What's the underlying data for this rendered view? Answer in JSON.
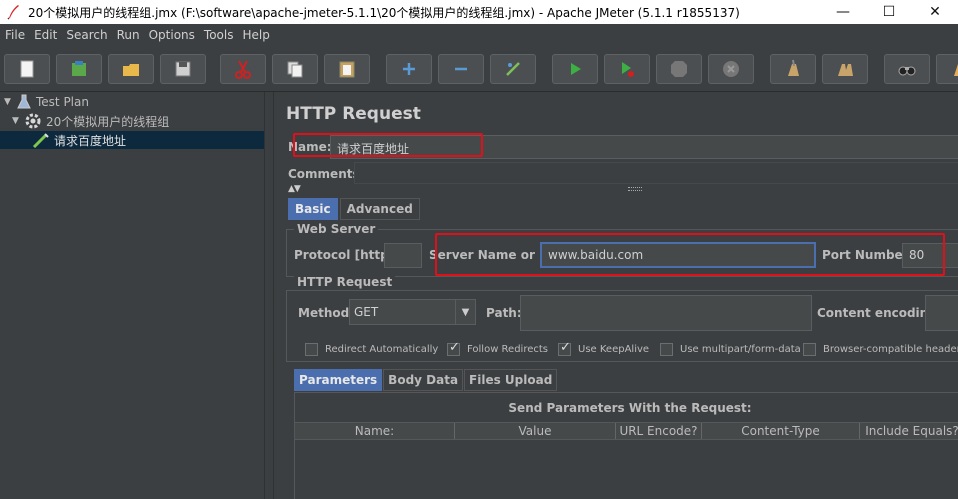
{
  "window": {
    "title": "20个模拟用户的线程组.jmx (F:\\software\\apache-jmeter-5.1.1\\20个模拟用户的线程组.jmx) - Apache JMeter (5.1.1 r1855137)",
    "minimize": "—",
    "maximize": "☐",
    "close": "✕"
  },
  "menu": [
    "File",
    "Edit",
    "Search",
    "Run",
    "Options",
    "Tools",
    "Help"
  ],
  "toolbar": {
    "icons": [
      "new-icon",
      "templates-icon",
      "open-icon",
      "save-icon",
      "cut-icon",
      "copy-icon",
      "paste-icon",
      "expand-icon",
      "collapse-icon",
      "toggle-icon",
      "start-icon",
      "start-no-pause-icon",
      "stop-icon",
      "shutdown-icon",
      "clear-icon",
      "clear-all-icon",
      "search-icon",
      "reset-search-icon"
    ]
  },
  "tree": {
    "items": [
      {
        "label": "Test Plan",
        "icon": "flask-icon",
        "expanded": true
      },
      {
        "label": "20个模拟用户的线程组",
        "icon": "gear-icon",
        "expanded": true
      },
      {
        "label": "请求百度地址",
        "icon": "pipette-icon",
        "selected": true
      }
    ]
  },
  "form": {
    "title": "HTTP Request",
    "name_label": "Name:",
    "name_value": "请求百度地址",
    "comments_label": "Comments:",
    "tabs": [
      "Basic",
      "Advanced"
    ],
    "web_server": {
      "title": "Web Server",
      "protocol_label": "Protocol [http]:",
      "protocol_value": "",
      "server_label": "Server Name or IP:",
      "server_value": "www.baidu.com",
      "port_label": "Port Number:",
      "port_value": "80"
    },
    "http_request": {
      "title": "HTTP Request",
      "method_label": "Method:",
      "method_value": "GET",
      "path_label": "Path:",
      "path_value": "",
      "encoding_label": "Content encoding:",
      "checkboxes": [
        {
          "label": "Redirect Automatically",
          "checked": false
        },
        {
          "label": "Follow Redirects",
          "checked": true
        },
        {
          "label": "Use KeepAlive",
          "checked": true
        },
        {
          "label": "Use multipart/form-data",
          "checked": false
        },
        {
          "label": "Browser-compatible header",
          "checked": false
        }
      ]
    },
    "subtabs": [
      "Parameters",
      "Body Data",
      "Files Upload"
    ],
    "params": {
      "title": "Send Parameters With the Request:",
      "columns": [
        "Name:",
        "Value",
        "URL Encode?",
        "Content-Type",
        "Include Equals?"
      ]
    }
  },
  "colors": {
    "background": "#3c3f41",
    "accent": "#4b6eaf",
    "annotation": "#e0101a"
  }
}
